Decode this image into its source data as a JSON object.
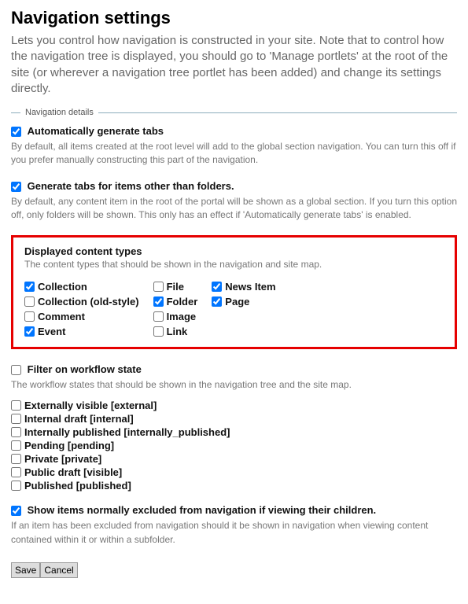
{
  "heading": "Navigation settings",
  "intro": "Lets you control how navigation is constructed in your site. Note that to control how the navigation tree is displayed, you should go to 'Manage portlets' at the root of the site (or wherever a navigation tree portlet has been added) and change its settings directly.",
  "legend": "Navigation details",
  "autoTabs": {
    "label": "Automatically generate tabs",
    "desc": "By default, all items created at the root level will add to the global section navigation. You can turn this off if you prefer manually constructing this part of the navigation.",
    "checked": true
  },
  "nonFolderTabs": {
    "label": "Generate tabs for items other than folders.",
    "desc": "By default, any content item in the root of the portal will be shown as a global section. If you turn this option off, only folders will be shown. This only has an effect if 'Automatically generate tabs' is enabled.",
    "checked": true
  },
  "displayedTypes": {
    "title": "Displayed content types",
    "desc": "The content types that should be shown in the navigation and site map.",
    "cols": [
      [
        {
          "label": "Collection",
          "checked": true
        },
        {
          "label": "Collection (old-style)",
          "checked": false
        },
        {
          "label": "Comment",
          "checked": false
        },
        {
          "label": "Event",
          "checked": true
        }
      ],
      [
        {
          "label": "File",
          "checked": false
        },
        {
          "label": "Folder",
          "checked": true
        },
        {
          "label": "Image",
          "checked": false
        },
        {
          "label": "Link",
          "checked": false
        }
      ],
      [
        {
          "label": "News Item",
          "checked": true
        },
        {
          "label": "Page",
          "checked": true
        }
      ]
    ]
  },
  "workflowFilter": {
    "label": "Filter on workflow state",
    "desc": "The workflow states that should be shown in the navigation tree and the site map.",
    "checked": false,
    "states": [
      {
        "label": "Externally visible [external]",
        "checked": false
      },
      {
        "label": "Internal draft [internal]",
        "checked": false
      },
      {
        "label": "Internally published [internally_published]",
        "checked": false
      },
      {
        "label": "Pending [pending]",
        "checked": false
      },
      {
        "label": "Private [private]",
        "checked": false
      },
      {
        "label": "Public draft [visible]",
        "checked": false
      },
      {
        "label": "Published [published]",
        "checked": false
      }
    ]
  },
  "showExcluded": {
    "label": "Show items normally excluded from navigation if viewing their children.",
    "desc": "If an item has been excluded from navigation should it be shown in navigation when viewing content contained within it or within a subfolder.",
    "checked": true
  },
  "buttons": {
    "save": "Save",
    "cancel": "Cancel"
  }
}
